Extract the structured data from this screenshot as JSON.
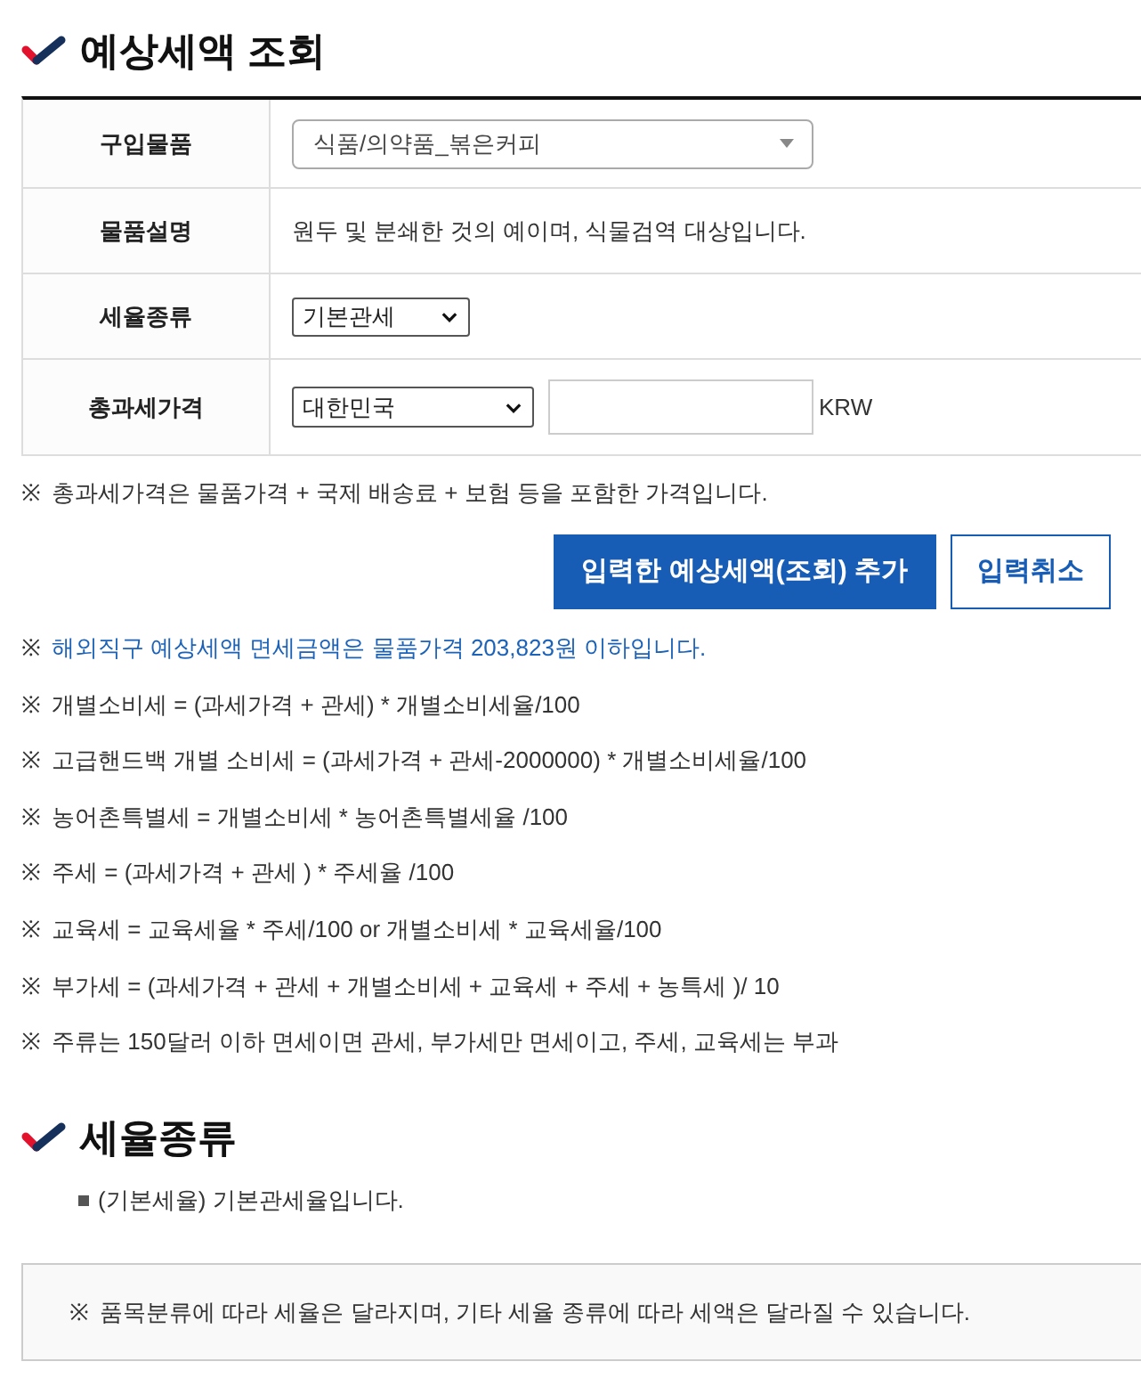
{
  "title": "예상세액 조회",
  "form": {
    "rows": [
      {
        "kind": "dropdown",
        "label": "구입물품",
        "value": "식품/의약품_볶은커피"
      },
      {
        "kind": "text",
        "label": "물품설명",
        "value": "원두 및 분쇄한 것의 예이며, 식물검역 대상입니다."
      },
      {
        "kind": "select",
        "label": "세율종류",
        "value": "기본관세"
      },
      {
        "kind": "price",
        "label": "총과세가격",
        "country": "대한민국",
        "unit": "KRW"
      }
    ]
  },
  "price_note": {
    "mark": "※",
    "text": "총과세가격은 물품가격 + 국제 배송료 + 보험 등을 포함한 가격입니다."
  },
  "buttons": [
    {
      "kind": "primary",
      "label": "입력한 예상세액(조회) 추가"
    },
    {
      "kind": "secondary",
      "label": "입력취소"
    }
  ],
  "notes": [
    {
      "kind": "highlight",
      "mark": "※",
      "text": "해외직구 예상세액 면세금액은 물품가격 203,823원 이하입니다."
    },
    {
      "kind": "plain",
      "mark": "※",
      "text": "개별소비세 = (과세가격 + 관세) * 개별소비세율/100"
    },
    {
      "kind": "plain",
      "mark": "※",
      "text": "고급핸드백 개별 소비세 = (과세가격 + 관세-2000000) * 개별소비세율/100"
    },
    {
      "kind": "plain",
      "mark": "※",
      "text": "농어촌특별세 = 개별소비세 * 농어촌특별세율 /100"
    },
    {
      "kind": "plain",
      "mark": "※",
      "text": "주세 = (과세가격 + 관세 ) * 주세율 /100"
    },
    {
      "kind": "plain",
      "mark": "※",
      "text": "교육세 = 교육세율 * 주세/100 or 개별소비세 * 교육세율/100"
    },
    {
      "kind": "plain",
      "mark": "※",
      "text": "부가세 = (과세가격 + 관세 + 개별소비세 + 교육세 + 주세 + 농특세 )/ 10"
    },
    {
      "kind": "plain",
      "mark": "※",
      "text": "주류는 150달러 이하 면세이면 관세, 부가세만 면세이고, 주세, 교육세는 부과"
    }
  ],
  "rate_section": {
    "title": "세율종류",
    "items": [
      "(기본세율) 기본관세율입니다."
    ],
    "notice": {
      "mark": "※",
      "text": "품목분류에 따라 세율은 달라지며, 기타 세율 종류에 따라 세액은 달라질 수 있습니다."
    }
  }
}
